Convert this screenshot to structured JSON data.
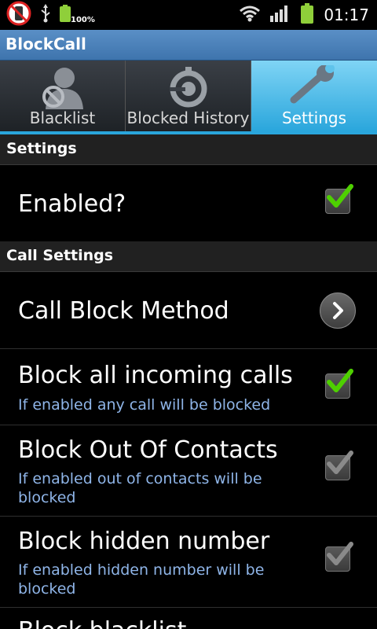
{
  "status_bar": {
    "battery_percent": "100%",
    "time": "01:17"
  },
  "app": {
    "title": "BlockCall"
  },
  "tabs": [
    {
      "label": "Blacklist",
      "icon": "user-blocked-icon",
      "selected": false
    },
    {
      "label": "Blocked History",
      "icon": "history-icon",
      "selected": false
    },
    {
      "label": "Settings",
      "icon": "wrench-icon",
      "selected": true
    }
  ],
  "sections": {
    "settings": "Settings",
    "call_settings": "Call Settings"
  },
  "settings": {
    "enabled": {
      "title": "Enabled?",
      "checked": true
    }
  },
  "call_settings": {
    "method": {
      "title": "Call Block Method"
    },
    "block_all": {
      "title": "Block all incoming calls",
      "subtitle": "If enabled any call will be blocked",
      "checked": true
    },
    "block_out_of_contacts": {
      "title": "Block Out Of Contacts",
      "subtitle": "If enabled out of contacts will be blocked",
      "checked": true,
      "enabled": false
    },
    "block_hidden": {
      "title": "Block hidden number",
      "subtitle": "If enabled hidden number will be blocked",
      "checked": true,
      "enabled": false
    },
    "block_blacklist": {
      "title": "Block blacklist"
    }
  },
  "colors": {
    "accent": "#2aa6dc",
    "title_bar": "#3e74ad",
    "subtitle": "#8fb5e8",
    "check_green": "#4ed000",
    "check_gray": "#8a8a8a"
  }
}
